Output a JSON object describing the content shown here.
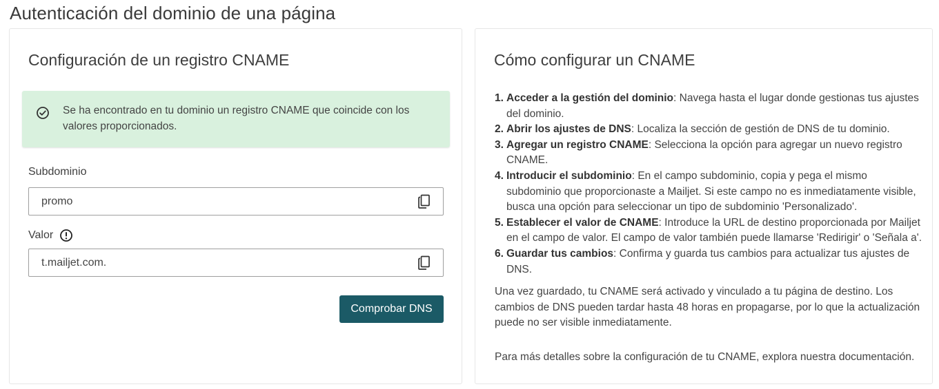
{
  "page": {
    "title": "Autenticación del dominio de una página"
  },
  "left_card": {
    "heading": "Configuración de un registro CNAME",
    "alert": {
      "icon": "check-circle-icon",
      "message": "Se ha encontrado en tu dominio un registro CNAME que coincide con los valores proporcionados."
    },
    "subdomain": {
      "label": "Subdominio",
      "value": "promo"
    },
    "value_field": {
      "label": "Valor",
      "value": "t.mailjet.com."
    },
    "check_button_label": "Comprobar DNS"
  },
  "right_card": {
    "heading": "Cómo configurar un CNAME",
    "steps": [
      {
        "number": "1.",
        "title": "Acceder a la gestión del dominio",
        "text": ": Navega hasta el lugar donde gestionas tus ajustes del dominio."
      },
      {
        "number": "2.",
        "title": "Abrir los ajustes de DNS",
        "text": ": Localiza la sección de gestión de DNS de tu dominio."
      },
      {
        "number": "3.",
        "title": "Agregar un registro CNAME",
        "text": ": Selecciona la opción para agregar un nuevo registro CNAME."
      },
      {
        "number": "4.",
        "title": "Introducir el subdominio",
        "text": ": En el campo subdominio, copia y pega el mismo subdominio que proporcionaste a Mailjet. Si este campo no es inmediatamente visible, busca una opción para seleccionar un tipo de subdominio 'Personalizado'."
      },
      {
        "number": "5.",
        "title": "Establecer el valor de CNAME",
        "text": ": Introduce la URL de destino proporcionada por Mailjet en el campo de valor. El campo de valor también puede llamarse 'Redirigir' o 'Señala a'."
      },
      {
        "number": "6.",
        "title": "Guardar tus cambios",
        "text": ": Confirma y guarda tus cambios para actualizar tus ajustes de DNS."
      }
    ],
    "after_text": "Una vez guardado, tu CNAME será activado y vinculado a tu página de destino. Los cambios de DNS pueden tardar hasta 48 horas en propagarse, por lo que la actualización puede no ser visible inmediatamente.",
    "docs_text": "Para más detalles sobre la configuración de tu CNAME, explora nuestra documentación."
  },
  "colors": {
    "success_bg": "#d9f1de",
    "button_bg": "#1b5a66",
    "border": "#e6e6e6"
  }
}
